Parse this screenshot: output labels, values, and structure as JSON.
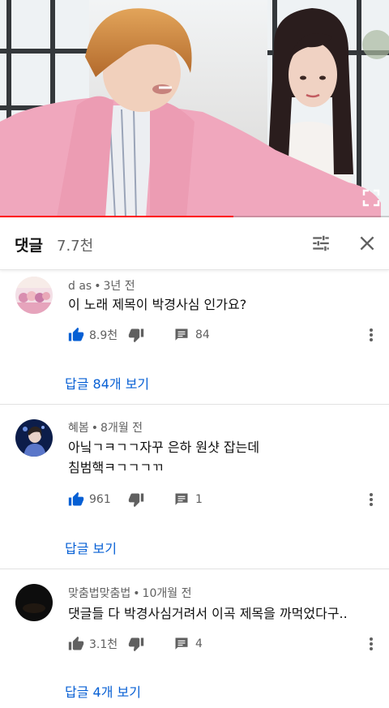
{
  "player": {
    "progress_fraction": 0.6
  },
  "comments_panel": {
    "title": "댓글",
    "count": "7.7천",
    "sort_icon": "sort-icon",
    "close_icon": "close-icon"
  },
  "comments": [
    {
      "author": "d as",
      "separator": "•",
      "time": "3년 전",
      "lines": [
        "이 노래 제목이 박경사심 인가요?"
      ],
      "likes": "8.9천",
      "liked": true,
      "reply_count": "84",
      "view_replies": "답글 84개 보기",
      "avatar_color": "#e9c7d6"
    },
    {
      "author": "혜봄",
      "separator": "•",
      "time": "8개월 전",
      "lines": [
        "아닠ㄱㅋㄱㄱ자꾸 은하 원샷 잡는데",
        "침범핵ㅋㄱㄱㄱㄲ"
      ],
      "likes": "961",
      "liked": true,
      "reply_count": "1",
      "view_replies": "답글 보기",
      "avatar_color": "#1f3f8a"
    },
    {
      "author": "맞춤법맞춤법",
      "separator": "•",
      "time": "10개월 전",
      "lines": [
        "댓글들 다 박경사심거려서 이곡 제목을 까먹었다구.."
      ],
      "likes": "3.1천",
      "liked": false,
      "reply_count": "4",
      "view_replies": "답글 4개 보기",
      "avatar_color": "#111111"
    }
  ],
  "colors": {
    "accent_blue": "#065fd4",
    "like_blue": "#065fd4",
    "progress_red": "#ff0000",
    "secondary_text": "#606060"
  }
}
